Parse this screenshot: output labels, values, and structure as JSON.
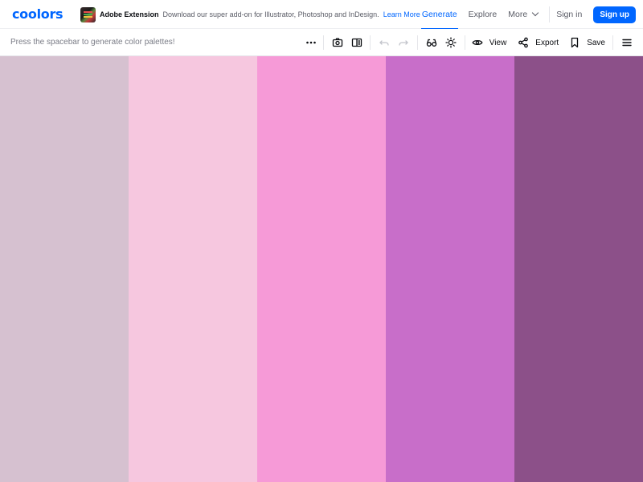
{
  "brand": {
    "logo_text": "coolors",
    "accent": "#0066ff"
  },
  "promo": {
    "title": "Adobe Extension",
    "text": "Download our super add-on for Illustrator, Photoshop and InDesign.",
    "link": "Learn More"
  },
  "nav": {
    "tabs": [
      {
        "label": "Generate",
        "active": true
      },
      {
        "label": "Explore",
        "active": false
      },
      {
        "label": "More",
        "active": false
      }
    ],
    "signin": "Sign in",
    "signup": "Sign up"
  },
  "toolbar": {
    "hint": "Press the spacebar to generate color palettes!",
    "view_label": "View",
    "export_label": "Export",
    "save_label": "Save",
    "icons": [
      "more-options-icon",
      "camera-icon",
      "layout-icon",
      "undo-icon",
      "redo-icon",
      "glasses-icon",
      "sun-icon",
      "eye-icon",
      "share-icon",
      "bookmark-icon",
      "hamburger-menu-icon"
    ]
  },
  "palette": {
    "colors": [
      "#d6c1d0",
      "#f6c7df",
      "#f69ad7",
      "#c86ec9",
      "#8c5089"
    ]
  }
}
